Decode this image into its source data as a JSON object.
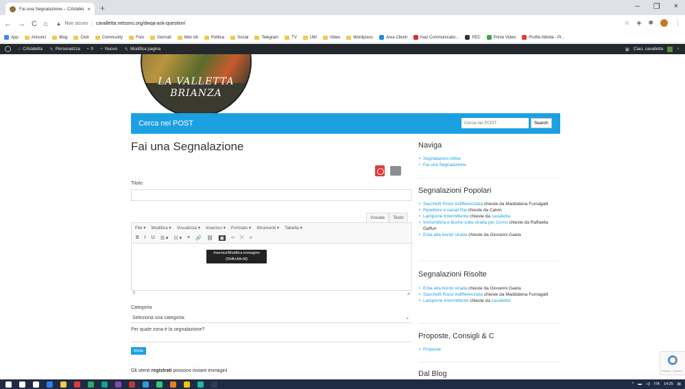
{
  "browser": {
    "tab_title": "Fai una Segnalazione – CAValletta",
    "tab_close": "×",
    "new_tab": "+",
    "window_controls": [
      "–",
      "❐",
      "×"
    ],
    "nav_icons": [
      "←",
      "→",
      "C",
      "⌂"
    ],
    "security_warning_icon": "▲",
    "security_label": "Non sicuro",
    "url": "cavalletta.netsons.org/dwqa-ask-question/",
    "bookmarks": [
      {
        "label": "App",
        "kind": "apps"
      },
      {
        "label": "Annunci",
        "kind": "folder"
      },
      {
        "label": "Blog",
        "kind": "folder"
      },
      {
        "label": "Club",
        "kind": "folder"
      },
      {
        "label": "Community",
        "kind": "folder"
      },
      {
        "label": "Foto",
        "kind": "folder"
      },
      {
        "label": "Giornali",
        "kind": "folder"
      },
      {
        "label": "Miei siti",
        "kind": "folder"
      },
      {
        "label": "Politica",
        "kind": "folder"
      },
      {
        "label": "Social",
        "kind": "folder"
      },
      {
        "label": "Telegram",
        "kind": "folder"
      },
      {
        "label": "TV",
        "kind": "folder"
      },
      {
        "label": "Utili",
        "kind": "folder"
      },
      {
        "label": "Video",
        "kind": "folder"
      },
      {
        "label": "Wordpress",
        "kind": "folder"
      },
      {
        "label": "Area Clienti",
        "kind": "site",
        "color": "#1e88e5"
      },
      {
        "label": "Inaz Communicatio...",
        "kind": "site",
        "color": "#d32f2f"
      },
      {
        "label": "PEC",
        "kind": "site",
        "color": "#333333"
      },
      {
        "label": "Prime Video",
        "kind": "site",
        "color": "#43a047"
      },
      {
        "label": "Profilo Attivita - Pi...",
        "kind": "site",
        "color": "#e53935"
      }
    ]
  },
  "wp_admin": {
    "site_name": "CAValletta",
    "customize": "Personalizza",
    "comments": "0",
    "new": "Nuovo",
    "edit_page": "Modifica pagina",
    "greeting": "Ciao, cavalletta"
  },
  "logo": {
    "line1": "LA VALLETTA",
    "line2": "BRIANZA"
  },
  "header": {
    "title": "Cerca nei POST",
    "search_placeholder": "Cerca nei POST",
    "search_button": "Search"
  },
  "form": {
    "page_title": "Fai una Segnalazione",
    "title_label": "Titolo",
    "editor_tabs": [
      "Visuale",
      "Testo"
    ],
    "menu": [
      "File ▾",
      "Modifica ▾",
      "Visualizza ▾",
      "Inserisci ▾",
      "Formato ▾",
      "Strumenti ▾",
      "Tabella ▾"
    ],
    "toolbar": [
      "B",
      "I",
      "U",
      "☰ ▾",
      "☷ ▾",
      "❝",
      "🔗",
      "⛓",
      "▣",
      "‹›",
      "⤫",
      "‹›"
    ],
    "tooltip_line1": "Inserisci/Modifica immagine",
    "tooltip_line2": "(Shift+Alt+M)",
    "path_status": "p",
    "category_label": "Categoria",
    "category_value": "Seleziona una categoria:",
    "zone_label": "Per quale zona è la segnalazione?",
    "submit": "Invia",
    "note_prefix": "Gli utenti ",
    "note_bold": "registrati",
    "note_suffix": " possono inviare immagini"
  },
  "sidebar": {
    "nav_title": "Naviga",
    "nav_items": [
      "Segnalazioni Attive",
      "Fai una Segnalazione"
    ],
    "popular_title": "Segnalazioni Popolari",
    "popular": [
      {
        "q": "Sacchetti Rossi indifferenziata",
        "by": "chieste da Maddalena Fumagalli"
      },
      {
        "q": "Ripetitore e canali Rai",
        "by": "chieste da Calvin"
      },
      {
        "q": "Lampione Intermittente",
        "by": "chieste da",
        "user": "cavalletta"
      },
      {
        "q": "Immondizia e buche sulla strada per Como",
        "by": "chieste da Raffaella Gaffuri"
      },
      {
        "q": "Erba alta bordo strada",
        "by": "chieste da Giovanni Gaeta"
      }
    ],
    "resolved_title": "Segnalazioni Risolte",
    "resolved": [
      {
        "q": "Erba alta bordo strada",
        "by": "chieste da Giovanni Gaeta"
      },
      {
        "q": "Sacchetti Rossi indifferenziata",
        "by": "chieste da Maddalena Fumagalli"
      },
      {
        "q": "Lampione Intermittente",
        "by": "chieste da",
        "user": "cavalletta"
      }
    ],
    "proposals_title": "Proposte, Consigli & C",
    "proposals": [
      "Proposte"
    ],
    "blog_title": "Dal Blog"
  },
  "recaptcha": {
    "text": "Privacy - Termini"
  },
  "taskbar": {
    "time": "14:25",
    "lang": "ITA",
    "apps": [
      {
        "name": "start-icon",
        "color": "#ffffff"
      },
      {
        "name": "search-icon",
        "color": "#ffffff"
      },
      {
        "name": "task-view-icon",
        "color": "#ffffff"
      },
      {
        "name": "mail-icon",
        "color": "#2f80ed"
      },
      {
        "name": "explorer-icon",
        "color": "#f2c94c"
      },
      {
        "name": "chrome-icon",
        "color": "#e53935"
      },
      {
        "name": "app-green-icon",
        "color": "#27ae60"
      },
      {
        "name": "app-teal-icon",
        "color": "#16a085"
      },
      {
        "name": "app-purple-icon",
        "color": "#8e44ad"
      },
      {
        "name": "app-red-icon",
        "color": "#c0392b"
      },
      {
        "name": "app-blue-icon",
        "color": "#3498db"
      },
      {
        "name": "app-lightgreen-icon",
        "color": "#2ecc71"
      },
      {
        "name": "app-orange-icon",
        "color": "#e67e22"
      },
      {
        "name": "app-yellow-icon",
        "color": "#f1c40f"
      },
      {
        "name": "app-cyan-icon",
        "color": "#1abc9c"
      },
      {
        "name": "app-navy-icon",
        "color": "#2c3e50"
      }
    ]
  }
}
